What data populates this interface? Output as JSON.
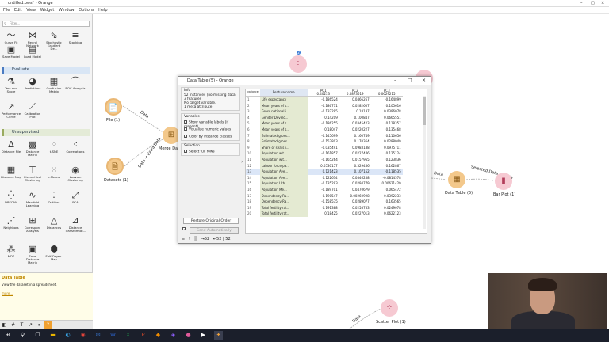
{
  "window": {
    "title": "untitled.ows* - Orange"
  },
  "menu": [
    "File",
    "Edit",
    "View",
    "Widget",
    "Window",
    "Options",
    "Help"
  ],
  "search": {
    "placeholder": "Filter..."
  },
  "widgets_top": [
    {
      "label": "Curve Fit",
      "icon": "curve-fit-icon"
    },
    {
      "label": "Neural Network",
      "icon": "neural-network-icon"
    },
    {
      "label": "Stochastic Gradient De...",
      "icon": "stochastic-gradient-icon"
    },
    {
      "label": "Stacking",
      "icon": "stacking-icon"
    },
    {
      "label": "Save Model",
      "icon": "save-model-icon"
    },
    {
      "label": "Load Model",
      "icon": "load-model-icon"
    }
  ],
  "categories": {
    "evaluate": "Evaluate",
    "unsupervised": "Unsupervised"
  },
  "widgets_evaluate": [
    {
      "label": "Test and Score"
    },
    {
      "label": "Predictions"
    },
    {
      "label": "Confusion Matrix"
    },
    {
      "label": "ROC Analysis"
    },
    {
      "label": "Performance Curve"
    },
    {
      "label": "Calibration Plot"
    }
  ],
  "widgets_unsupervised": [
    {
      "label": "Distance File"
    },
    {
      "label": "Distance Matrix"
    },
    {
      "label": "t-SNE"
    },
    {
      "label": "Correlations"
    },
    {
      "label": "Distance Map"
    },
    {
      "label": "Hierarchical Clustering"
    },
    {
      "label": "k-Means"
    },
    {
      "label": "Louvain Clustering"
    },
    {
      "label": "DBSCAN"
    },
    {
      "label": "Manifold Learning"
    },
    {
      "label": "Outliers"
    },
    {
      "label": "PCA"
    },
    {
      "label": "Neighbors"
    },
    {
      "label": "Correspon. Analysis"
    },
    {
      "label": "Distances"
    },
    {
      "label": "Distance Transformat..."
    },
    {
      "label": "MDS"
    },
    {
      "label": "Save Distance Matrix"
    },
    {
      "label": "Self-Organ. Map"
    }
  ],
  "info_panel": {
    "title": "Data Table",
    "description": "View the dataset in a spreadsheet.",
    "more": "more..."
  },
  "canvas": {
    "nodes": {
      "file1": "File (1)",
      "datasets1": "Datasets (1)",
      "merge": "Merge Data",
      "datatable5": "Data Table (5)",
      "barplot1": "Bar Plot (1)",
      "scatter1": "Scatter Plot (1)"
    },
    "links": {
      "data1": "Data",
      "extra": "Data → Extra Data",
      "data2": "Data",
      "selected": "Selected Data → Data",
      "data3": "Data"
    },
    "badge": "2"
  },
  "dialog": {
    "title": "Data Table (5) - Orange",
    "info": {
      "header": "Info",
      "lines": [
        "52 instances (no missing data)",
        "3 features",
        "No target variable.",
        "1 meta attribute"
      ]
    },
    "variables": {
      "header": "Variables",
      "options": [
        {
          "label": "Show variable labels (if present)",
          "checked": true
        },
        {
          "label": "Visualize numeric values",
          "checked": false
        },
        {
          "label": "Color by instance classes",
          "checked": true
        }
      ]
    },
    "selection": {
      "header": "Selection",
      "option": "Select full rows",
      "checked": true
    },
    "restore_button": "Restore Original Order",
    "send_button": "Send Automatically",
    "status": {
      "in": "52",
      "out": "52 | 52"
    },
    "table": {
      "corner": "variance",
      "columns": [
        {
          "name": "Feature name",
          "sub": ""
        },
        {
          "name": "PC1",
          "sub": "0.40233"
        },
        {
          "name": "PC2",
          "sub": "0.0873619"
        },
        {
          "name": "PC3",
          "sub": "0.0629215"
        }
      ],
      "rows": [
        [
          "1",
          "Life expectancy",
          "-0.186524",
          "0.0466267",
          "-0.164899"
        ],
        [
          "2",
          "Mean years of s...",
          "-0.186771",
          "0.0282607",
          "0.105616"
        ],
        [
          "3",
          "Gross national i...",
          "-0.132295",
          "0.18137",
          "0.0396078"
        ],
        [
          "4",
          "Gender Develo...",
          "-0.14209",
          "0.100847",
          "0.0665551"
        ],
        [
          "5",
          "Mean years of s...",
          "-0.186255",
          "0.0345423",
          "0.118357"
        ],
        [
          "6",
          "Mean years of s...",
          "-0.18047",
          "0.0220227",
          "0.135468"
        ],
        [
          "7",
          "Estimated gross...",
          "-0.145699",
          "0.160749",
          "0.110656"
        ],
        [
          "8",
          "Estimated gross...",
          "-0.153803",
          "0.170364",
          "0.0288049"
        ],
        [
          "9",
          "Share of seats i...",
          "-0.035491",
          "0.0983188",
          "0.0975711"
        ],
        [
          "10",
          "Population wit...",
          "-0.161857",
          "0.0227446",
          "0.125124"
        ],
        [
          "11",
          "Population wit...",
          "-0.165264",
          "0.0157965",
          "0.123836"
        ],
        [
          "12",
          "Labour force pa...",
          "0.0530157",
          "0.329456",
          "0.162867"
        ],
        [
          "13",
          "Population Ave...",
          "0.121423",
          "0.107152",
          "-0.118535"
        ],
        [
          "14",
          "Population Ave...",
          "0.122674",
          "0.0846258",
          "-0.0814578"
        ],
        [
          "15",
          "Population Urb...",
          "-0.135293",
          "0.0294779",
          "0.00621429"
        ],
        [
          "16",
          "Population Me...",
          "-0.189701",
          "0.0470679",
          "0.065472"
        ],
        [
          "17",
          "Dependency Ra...",
          "0.190547",
          "0.00260998",
          "0.0392233"
        ],
        [
          "18",
          "Dependency Ra...",
          "-0.158535",
          "0.0289077",
          "0.163565"
        ],
        [
          "19",
          "Total fertility rat...",
          "0.191388",
          "0.0258753",
          "0.0249078"
        ],
        [
          "20",
          "Total fertility rat...",
          "0.18425",
          "0.0227013",
          "0.0622123"
        ]
      ]
    }
  },
  "colors": {
    "accent": "#4a7bc2",
    "node_orange": "#f3c88b",
    "node_pink": "#f6c9d2",
    "feature_col": "#e4ead2"
  }
}
